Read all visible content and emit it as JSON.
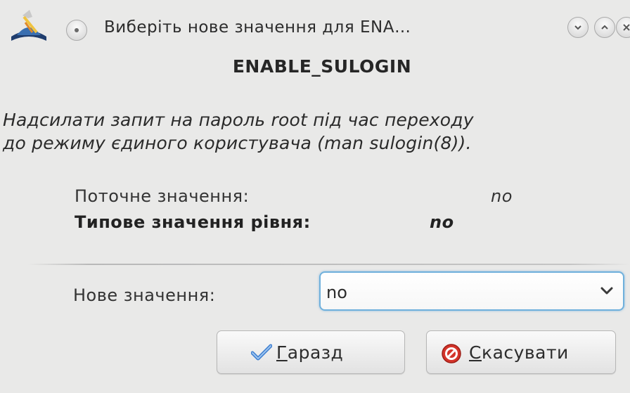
{
  "window": {
    "title": "Виберіть нове значення для ENA…",
    "app_icon": "drakconf-hat-icon",
    "controls": {
      "menu_icon": "window-menu-icon",
      "minimize_icon": "minimize-icon",
      "maximize_icon": "maximize-icon",
      "close_icon": "close-icon"
    }
  },
  "option": {
    "name": "ENABLE_SULOGIN",
    "description_line1": "Надсилати запит на пароль root під час переходу",
    "description_line2": "до режиму єдиного користувача (man sulogin(8))."
  },
  "values": {
    "current_label": "Поточне значення:",
    "current_value": "no",
    "default_label": "Типове значення рівня:",
    "default_value": "no"
  },
  "new_value": {
    "label": "Нове значення:",
    "selected": "no"
  },
  "buttons": {
    "ok": {
      "mnemonic": "Г",
      "rest": "аразд",
      "icon": "checkmark-icon"
    },
    "cancel": {
      "mnemonic": "С",
      "rest": "касувати",
      "icon": "cancel-icon"
    }
  },
  "colors": {
    "focus_border": "#6fb0dc",
    "checkmark": "#3f7fd0",
    "cancel_red": "#d4342a",
    "background": "#e9e9e8"
  }
}
